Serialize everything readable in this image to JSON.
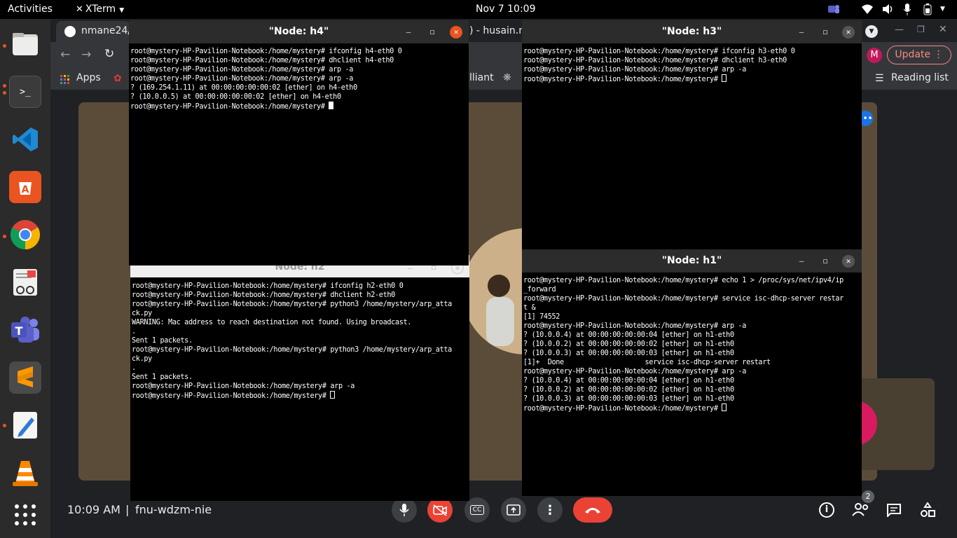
{
  "topbar": {
    "activities": "Activities",
    "app_menu": "XTerm",
    "clock": "Nov 7  10:09"
  },
  "browser": {
    "tab_label": "nmane24/",
    "tab_label_2": ") - husain.m",
    "apps_label": "Apps",
    "bookmark_partial": "lliant",
    "update_label": "Update",
    "reading_list": "Reading list",
    "profile_initial": "M"
  },
  "meet": {
    "time": "10:09 AM",
    "meeting_code": "fnu-wdzm-nie",
    "participants_badge": "2",
    "colors": {
      "end_call": "#ea4335",
      "cam_off": "#ea4335"
    }
  },
  "terminals": {
    "h4": {
      "title": "\"Node: h4\"",
      "lines": "root@mystery-HP-Pavilion-Notebook:/home/mystery# ifconfig h4-eth0 0\nroot@mystery-HP-Pavilion-Notebook:/home/mystery# dhclient h4-eth0\nroot@mystery-HP-Pavilion-Notebook:/home/mystery# arp -a\nroot@mystery-HP-Pavilion-Notebook:/home/mystery# arp -a\n? (169.254.1.11) at 00:00:00:00:00:02 [ether] on h4-eth0\n? (10.0.0.5) at 00:00:00:00:00:02 [ether] on h4-eth0\nroot@mystery-HP-Pavilion-Notebook:/home/mystery# "
    },
    "h3": {
      "title": "\"Node: h3\"",
      "lines": "root@mystery-HP-Pavilion-Notebook:/home/mystery# ifconfig h3-eth0 0\nroot@mystery-HP-Pavilion-Notebook:/home/mystery# dhclient h3-eth0\nroot@mystery-HP-Pavilion-Notebook:/home/mystery# arp -a\nroot@mystery-HP-Pavilion-Notebook:/home/mystery# "
    },
    "h2": {
      "title": "\"Node: h2\"",
      "lines": "root@mystery-HP-Pavilion-Notebook:/home/mystery# ifconfig h2-eth0 0\nroot@mystery-HP-Pavilion-Notebook:/home/mystery# dhclient h2-eth0\nroot@mystery-HP-Pavilion-Notebook:/home/mystery# python3 /home/mystery/arp_atta\nck.py\nWARNING: Mac address to reach destination not found. Using broadcast.\n.\nSent 1 packets.\nroot@mystery-HP-Pavilion-Notebook:/home/mystery# python3 /home/mystery/arp_atta\nck.py\n.\nSent 1 packets.\nroot@mystery-HP-Pavilion-Notebook:/home/mystery# arp -a\nroot@mystery-HP-Pavilion-Notebook:/home/mystery# "
    },
    "h1": {
      "title": "\"Node: h1\"",
      "lines": "root@mystery-HP-Pavilion-Notebook:/home/mystery# echo 1 > /proc/sys/net/ipv4/ip\n_forward\nroot@mystery-HP-Pavilion-Notebook:/home/mystery# service isc-dhcp-server restar\nt &\n[1] 74552\nroot@mystery-HP-Pavilion-Notebook:/home/mystery# arp -a\n? (10.0.0.4) at 00:00:00:00:00:04 [ether] on h1-eth0\n? (10.0.0.2) at 00:00:00:00:00:02 [ether] on h1-eth0\n? (10.0.0.3) at 00:00:00:00:00:03 [ether] on h1-eth0\n[1]+  Done                    service isc-dhcp-server restart\nroot@mystery-HP-Pavilion-Notebook:/home/mystery# arp -a\n? (10.0.0.4) at 00:00:00:00:00:04 [ether] on h1-eth0\n? (10.0.0.2) at 00:00:00:00:00:02 [ether] on h1-eth0\n? (10.0.0.3) at 00:00:00:00:00:03 [ether] on h1-eth0\nroot@mystery-HP-Pavilion-Notebook:/home/mystery# "
    }
  }
}
